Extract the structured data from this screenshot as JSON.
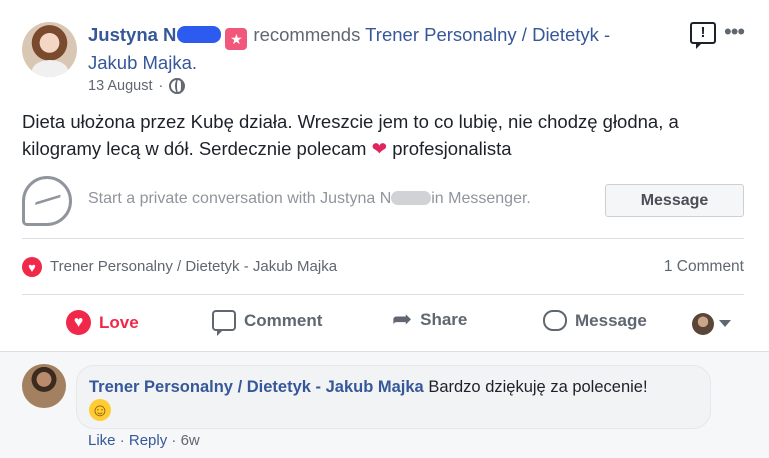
{
  "post": {
    "author": "Justyna N",
    "verb": "recommends",
    "page_name": "Trener Personalny / Dietetyk - Jakub Majka.",
    "date": "13 August",
    "text_before_heart": "Dieta ułożona przez Kubę działa. Wreszcie jem to co lubię, nie chodzę głodna, a kilogramy lecą w dół. Serdecznie polecam",
    "heart_glyph": "❤",
    "text_after_heart": "profesjonalista"
  },
  "messenger": {
    "prompt_before": "Start a private conversation with Justyna N",
    "prompt_after": "in Messenger.",
    "button_label": "Message"
  },
  "reactions": {
    "label": "Trener Personalny / Dietetyk - Jakub Majka",
    "comment_count": "1 Comment"
  },
  "actions": {
    "love": "Love",
    "comment": "Comment",
    "share": "Share",
    "message": "Message"
  },
  "comment": {
    "author": "Trener Personalny / Dietetyk - Jakub Majka",
    "text": "Bardzo dziękuję za polecenie!",
    "like": "Like",
    "reply": "Reply",
    "separator": "·",
    "age": "6w"
  },
  "colors": {
    "link": "#365899",
    "love": "#f0284a",
    "muted": "#606770"
  },
  "icons": [
    "globe-icon",
    "report-icon",
    "more-icon",
    "messenger-icon",
    "love-reaction-icon",
    "comment-icon",
    "share-icon",
    "message-icon",
    "smile-emoji-icon"
  ]
}
